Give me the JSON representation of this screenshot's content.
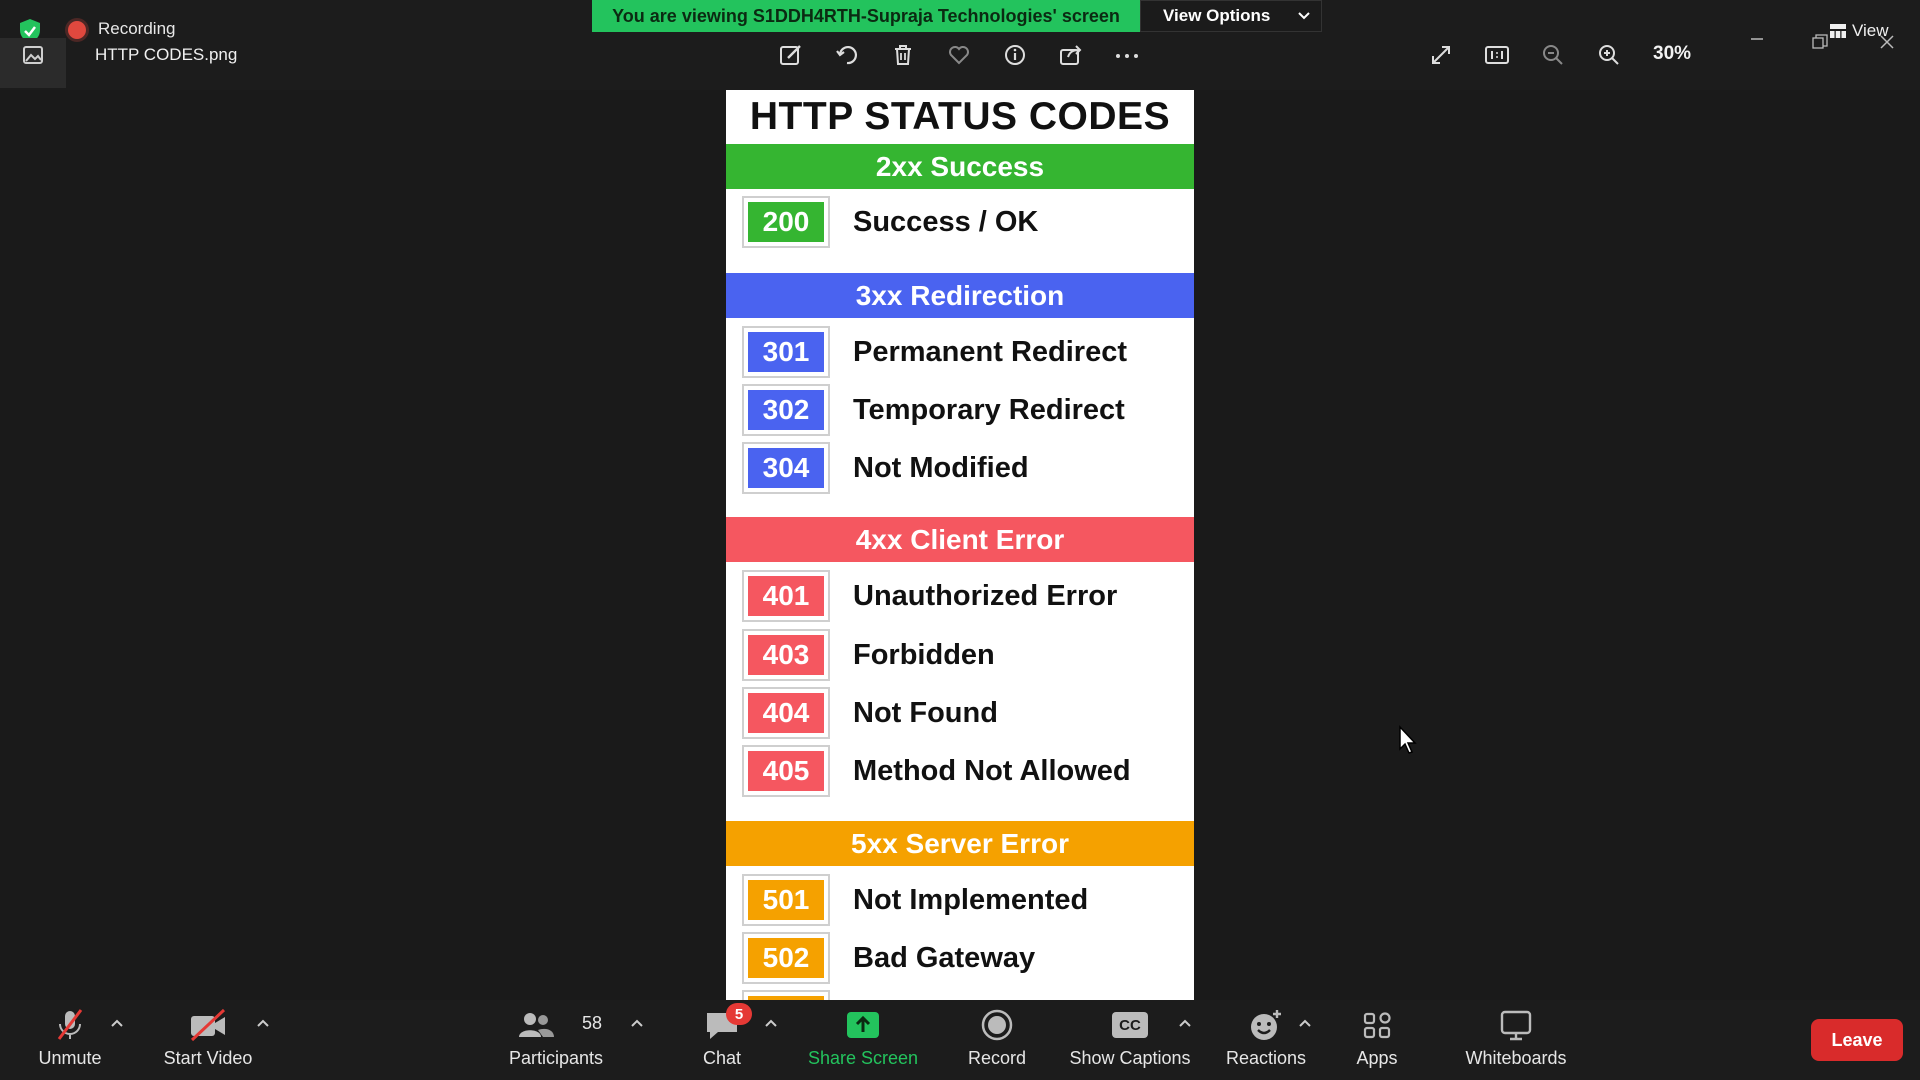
{
  "recording": {
    "label": "Recording"
  },
  "file": {
    "name": "HTTP CODES.png"
  },
  "banner": {
    "viewing_text": "You are viewing S1DDH4RTH-Supraja Technologies' screen",
    "view_options_label": "View Options"
  },
  "viewer": {
    "zoom": "30%",
    "view_label": "View"
  },
  "document": {
    "title": "HTTP STATUS CODES",
    "sections": [
      {
        "header": "2xx Success",
        "color": "#35b531",
        "codes": [
          {
            "code": "200",
            "label": "Success / OK"
          }
        ]
      },
      {
        "header": "3xx Redirection",
        "color": "#4a63f0",
        "codes": [
          {
            "code": "301",
            "label": "Permanent Redirect"
          },
          {
            "code": "302",
            "label": "Temporary Redirect"
          },
          {
            "code": "304",
            "label": "Not Modified"
          }
        ]
      },
      {
        "header": "4xx Client Error",
        "color": "#f55760",
        "codes": [
          {
            "code": "401",
            "label": "Unauthorized Error"
          },
          {
            "code": "403",
            "label": "Forbidden"
          },
          {
            "code": "404",
            "label": "Not Found"
          },
          {
            "code": "405",
            "label": "Method Not Allowed"
          }
        ]
      },
      {
        "header": "5xx Server Error",
        "color": "#f5a100",
        "codes": [
          {
            "code": "501",
            "label": "Not Implemented"
          },
          {
            "code": "502",
            "label": "Bad Gateway"
          }
        ]
      }
    ]
  },
  "toolbar": {
    "unmute": "Unmute",
    "start_video": "Start Video",
    "participants": "Participants",
    "participant_count": "58",
    "chat": "Chat",
    "chat_badge": "5",
    "share_screen": "Share Screen",
    "record": "Record",
    "captions": "Show Captions",
    "cc_glyph": "CC",
    "reactions": "Reactions",
    "apps": "Apps",
    "whiteboards": "Whiteboards",
    "leave": "Leave"
  },
  "colors": {
    "banner_green": "#23c35d",
    "leave_red": "#d92b2b",
    "share_green": "#23c35d"
  }
}
